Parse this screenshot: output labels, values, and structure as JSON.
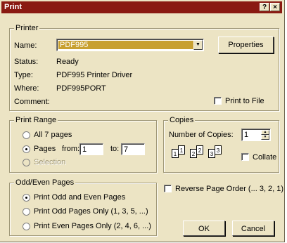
{
  "window": {
    "title": "Print",
    "help_label": "?",
    "close_label": "×"
  },
  "printer": {
    "legend": "Printer",
    "name_label": "Name:",
    "name_value": "PDF995",
    "properties_label": "Properties",
    "status_label": "Status:",
    "status_value": "Ready",
    "type_label": "Type:",
    "type_value": "PDF995 Printer Driver",
    "where_label": "Where:",
    "where_value": "PDF995PORT",
    "comment_label": "Comment:",
    "print_to_file_label": "Print to File"
  },
  "print_range": {
    "legend": "Print Range",
    "all_label": "All 7 pages",
    "pages_label": "Pages",
    "from_label": "from:",
    "from_value": "1",
    "to_label": "to:",
    "to_value": "7",
    "selection_label": "Selection"
  },
  "copies": {
    "legend": "Copies",
    "number_label": "Number of Copies:",
    "number_value": "1",
    "collate_label": "Collate",
    "page_numbers": [
      "1",
      "1",
      "2",
      "2",
      "3",
      "3"
    ]
  },
  "odd_even": {
    "legend": "Odd/Even Pages",
    "both_label": "Print Odd and Even Pages",
    "odd_label": "Print Odd Pages Only  (1, 3, 5, ...)",
    "even_label": "Print Even Pages Only  (2, 4, 6, ...)"
  },
  "reverse_label": "Reverse Page Order  (... 3, 2, 1)",
  "ok_label": "OK",
  "cancel_label": "Cancel",
  "colors": {
    "title_bar": "#8a1a12",
    "dialog_face": "#ece4c4",
    "selected_field": "#c8a030"
  }
}
